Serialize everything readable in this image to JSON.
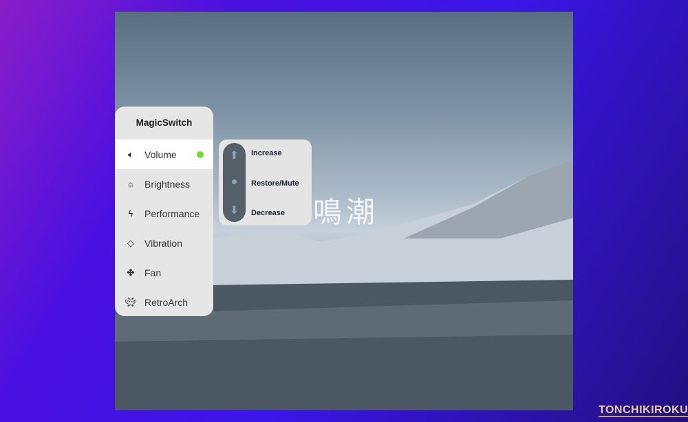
{
  "game_logo": "鳴潮",
  "menu": {
    "title": "MagicSwitch",
    "items": [
      {
        "label": "Volume",
        "icon": "speaker-icon",
        "selected": true,
        "status": "active",
        "status_color": "#6ce02a"
      },
      {
        "label": "Brightness",
        "icon": "sun-icon"
      },
      {
        "label": "Performance",
        "icon": "lightning-icon"
      },
      {
        "label": "Vibration",
        "icon": "vibration-icon"
      },
      {
        "label": "Fan",
        "icon": "fan-icon"
      },
      {
        "label": "RetroArch",
        "icon": "retroarch-icon"
      }
    ]
  },
  "submenu": {
    "items": [
      {
        "label": "Increase",
        "icon": "arrow-up-icon"
      },
      {
        "label": "Restore/Mute",
        "icon": "circle-icon"
      },
      {
        "label": "Decrease",
        "icon": "arrow-down-icon"
      }
    ]
  },
  "watermark": "TONCHIKIROKU"
}
